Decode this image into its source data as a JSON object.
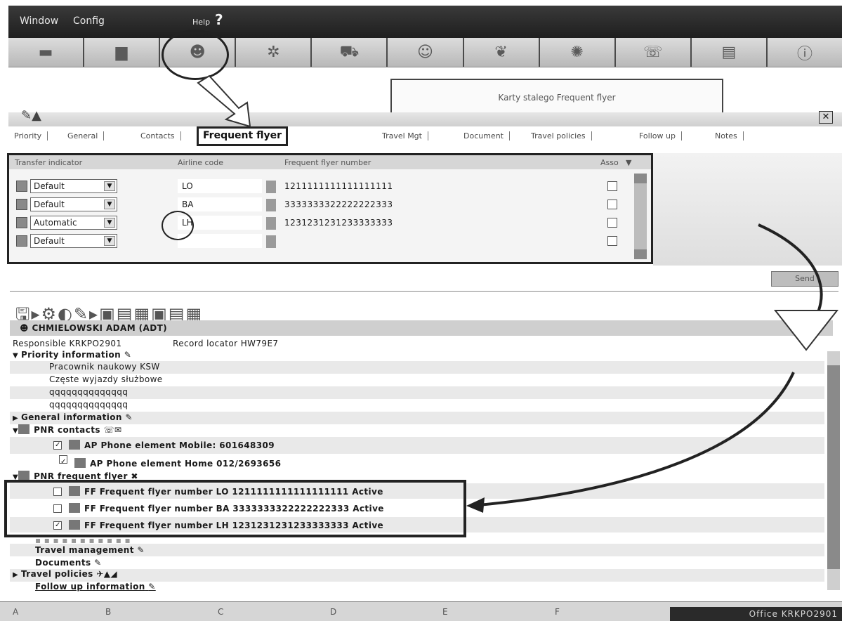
{
  "menubar": {
    "window": "Window",
    "config": "Config",
    "help": "Help",
    "help_mark": "?"
  },
  "toolbar": {
    "icons": [
      "folder-icon",
      "monitor-icon",
      "person-icon",
      "star-icon",
      "car-icon",
      "agent-icon",
      "globe-icon",
      "planet-icon",
      "phone-icon",
      "book-icon",
      "info-icon"
    ]
  },
  "callout": "Karty stalego Frequent flyer",
  "tabs": [
    "Priority",
    "General",
    "Contacts",
    "Frequent flyer",
    "Travel Mgt",
    "Document",
    "Travel policies",
    "Follow up",
    "Notes"
  ],
  "ff_grid": {
    "headers": {
      "transfer": "Transfer indicator",
      "airline": "Airline code",
      "number": "Frequent flyer number",
      "asso": "Asso"
    },
    "rows": [
      {
        "indicator": "Default",
        "airline": "LO",
        "number": "1211111111111111111"
      },
      {
        "indicator": "Default",
        "airline": "BA",
        "number": "3333333322222222333"
      },
      {
        "indicator": "Automatic",
        "airline": "LH",
        "number": "1231231231233333333"
      },
      {
        "indicator": "Default",
        "airline": "",
        "number": ""
      }
    ]
  },
  "send": "Send",
  "pnr": {
    "passenger": "CHMIELOWSKI ADAM (ADT)",
    "responsible": "Responsible  KRKPO2901",
    "record_locator": "Record locator  HW79E7",
    "priority_info": "Priority information",
    "priority_lines": [
      "Pracownik naukowy KSW",
      "Częste wyjazdy służbowe",
      "qqqqqqqqqqqqqq",
      "qqqqqqqqqqqqqq"
    ],
    "general_info": "General information",
    "contacts": "PNR contacts",
    "contact_lines": [
      "AP Phone element Mobile: 601648309",
      "AP Phone element Home  012/2693656"
    ],
    "ff_header": "PNR frequent flyer",
    "ff_lines": [
      "FF Frequent flyer number LO 1211111111111111111 Active",
      "FF Frequent flyer number BA 3333333322222222333 Active",
      "FF Frequent flyer number LH 1231231231233333333 Active"
    ],
    "travel_mgmt": "Travel management",
    "documents": "Documents",
    "travel_policies": "Travel policies",
    "follow_up": "Follow up information"
  },
  "status": {
    "a": "A",
    "b": "B",
    "c": "C",
    "d": "D",
    "e": "E",
    "f": "F",
    "office": "Office  KRKPO2901"
  }
}
